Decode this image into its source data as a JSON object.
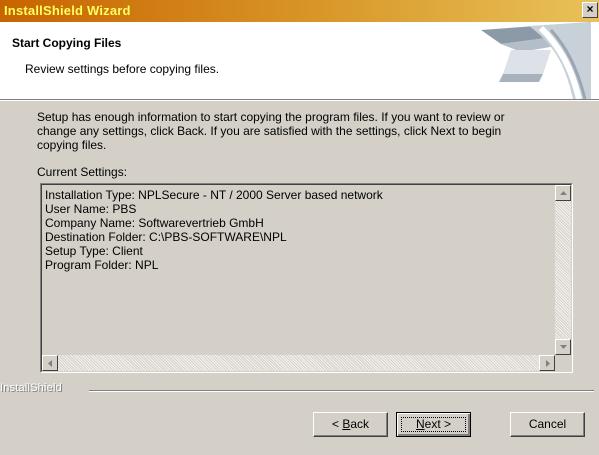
{
  "window": {
    "title": "InstallShield Wizard",
    "close_glyph": "×"
  },
  "header": {
    "title": "Start Copying Files",
    "subtitle": "Review settings before copying files."
  },
  "body": {
    "intro_lines": [
      "Setup has enough information to start copying the program files.  If you want to review or",
      "change any settings, click Back.  If you are satisfied with the settings, click Next to begin",
      "copying files."
    ],
    "current_settings_label": "Current Settings:",
    "settings_lines": [
      "Installation Type: NPLSecure - NT / 2000 Server based network",
      "User Name: PBS",
      "Company Name: Softwarevertrieb GmbH",
      "Destination Folder: C:\\PBS-SOFTWARE\\NPL",
      "Setup Type: Client",
      "Program Folder: NPL"
    ]
  },
  "footer": {
    "brand": "InstallShield"
  },
  "buttons": {
    "back": {
      "prefix": "< ",
      "accel": "B",
      "rest": "ack"
    },
    "next": {
      "accel": "N",
      "rest": "ext >"
    },
    "cancel": "Cancel"
  },
  "colors": {
    "title_text": "#ffff60",
    "title_bar_start": "#c86400",
    "title_bar_end": "#e8c25a",
    "dialog_face": "#d4d0c8",
    "header_bg": "#ffffff"
  },
  "icons": {
    "close": "close-icon",
    "scroll_up": "arrow-up-icon",
    "scroll_down": "arrow-down-icon",
    "scroll_left": "arrow-left-icon",
    "scroll_right": "arrow-right-icon",
    "header_graphic": "wizard-graphic"
  }
}
